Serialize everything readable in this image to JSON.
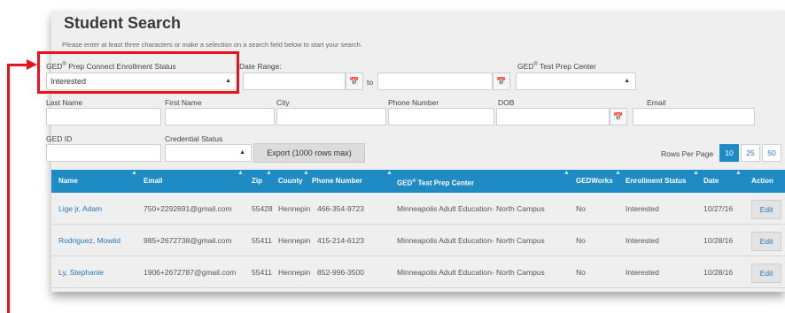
{
  "page_title": "Student Search",
  "hint": "Please enter at least three characters or make a selection on a search field below to start your search.",
  "filters": {
    "ged_enrollment_status": {
      "label_pre": "GED",
      "label_sup": "®",
      "label_post": " Prep Connect Enrollment Status",
      "value": "Interested"
    },
    "date_range": {
      "label": "Date Range:",
      "from": "",
      "to_label": "to",
      "to": ""
    },
    "test_prep_center": {
      "label_pre": "GED",
      "label_sup": "®",
      "label_post": " Test Prep Center",
      "value": ""
    },
    "last_name": {
      "label": "Last Name",
      "value": ""
    },
    "first_name": {
      "label": "First Name",
      "value": ""
    },
    "city": {
      "label": "City",
      "value": ""
    },
    "phone_number": {
      "label": "Phone Number",
      "value": ""
    },
    "dob": {
      "label": "DOB",
      "value": ""
    },
    "email": {
      "label": "Email",
      "value": ""
    },
    "ged_id": {
      "label": "GED ID",
      "value": ""
    },
    "credential_status": {
      "label": "Credential Status",
      "value": ""
    }
  },
  "export_label": "Export (1000 rows max)",
  "rows_per_page": {
    "label": "Rows Per Page",
    "options": [
      "10",
      "25",
      "50"
    ],
    "selected": "10"
  },
  "table": {
    "headers": {
      "name": "Name",
      "email": "Email",
      "zip": "Zip",
      "county": "County",
      "phone": "Phone Number",
      "center_pre": "GED",
      "center_sup": "®",
      "center_post": " Test Prep Center",
      "gedworks": "GEDWorks",
      "enrollment": "Enrollment Status",
      "date": "Date",
      "action": "Action"
    },
    "rows": [
      {
        "name": "Lige jr, Adam",
        "email": "750+2292691@gmail.com",
        "zip": "55428",
        "county": "Hennepin",
        "phone": "466-354-9723",
        "center": "Minneapolis Adult Education- North Campus",
        "gedworks": "No",
        "enrollment": "Interested",
        "date": "10/27/16",
        "action": "Edit"
      },
      {
        "name": "Rodriguez, Mowlid",
        "email": "985+2672738@gmail.com",
        "zip": "55411",
        "county": "Hennepin",
        "phone": "415-214-6123",
        "center": "Minneapolis Adult Education- North Campus",
        "gedworks": "No",
        "enrollment": "Interested",
        "date": "10/28/16",
        "action": "Edit"
      },
      {
        "name": "Ly, Stephanie",
        "email": "1906+2672787@gmail.com",
        "zip": "55411",
        "county": "Hennepin",
        "phone": "852-996-3500",
        "center": "Minneapolis Adult Education- North Campus",
        "gedworks": "No",
        "enrollment": "Interested",
        "date": "10/28/16",
        "action": "Edit"
      }
    ]
  },
  "icons": {
    "calendar": "calendar-icon",
    "sort": "sort-icon",
    "dropdown": "chevron-down-icon"
  },
  "colors": {
    "header_blue": "#1f8bc4",
    "link_blue": "#2a78b5",
    "highlight_red": "#e8131b"
  }
}
